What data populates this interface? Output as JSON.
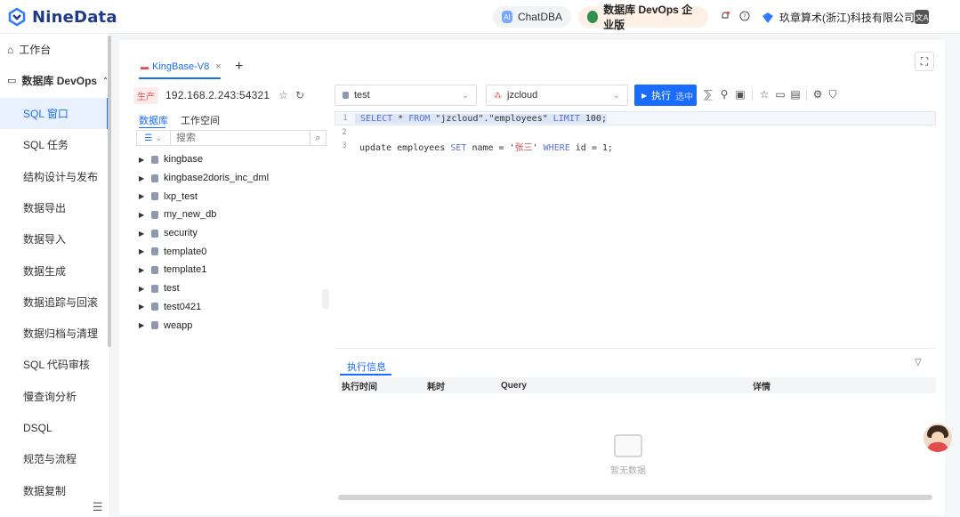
{
  "app": {
    "logo_text": "NineData",
    "chatdba_label": "ChatDBA",
    "devops_label": "数据库 DevOps 企业版",
    "org_name": "玖章算术(浙江)科技有限公司",
    "lang_label": "文A"
  },
  "sidebar": {
    "workbench": "工作台",
    "group": "数据库 DevOps",
    "items": [
      "SQL 窗口",
      "SQL 任务",
      "结构设计与发布",
      "数据导出",
      "数据导入",
      "数据生成",
      "数据追踪与回滚",
      "数据归档与清理",
      "SQL 代码审核",
      "慢查询分析",
      "DSQL",
      "规范与流程",
      "数据复制"
    ],
    "active_index": 0
  },
  "connection": {
    "tab_label": "KingBase-V8",
    "env_badge": "生产",
    "host": "192.168.2.243:54321"
  },
  "db_panel": {
    "tabs": [
      "数据库",
      "工作空间"
    ],
    "search_placeholder": "搜索",
    "databases": [
      "kingbase",
      "kingbase2doris_inc_dml",
      "lxp_test",
      "my_new_db",
      "security",
      "template0",
      "template1",
      "test",
      "test0421",
      "weapp"
    ]
  },
  "editor": {
    "database": "test",
    "schema": "jzcloud",
    "run_label": "执行",
    "run_extra": "选中",
    "lines": [
      {
        "n": "1",
        "parts": [
          [
            "kw",
            "SELECT"
          ],
          [
            "p",
            " * "
          ],
          [
            "kw",
            "FROM"
          ],
          [
            "p",
            " \"jzcloud\".\"employees\" "
          ],
          [
            "kw",
            "LIMIT"
          ],
          [
            "p",
            " 100;"
          ]
        ]
      },
      {
        "n": "2",
        "parts": []
      },
      {
        "n": "3",
        "parts": [
          [
            "p",
            "update employees "
          ],
          [
            "kw",
            "SET"
          ],
          [
            "p",
            " name = '"
          ],
          [
            "cn",
            "张三"
          ],
          [
            "p",
            "' "
          ],
          [
            "kw",
            "WHERE"
          ],
          [
            "p",
            " id = 1;"
          ]
        ]
      }
    ]
  },
  "result": {
    "tab_label": "执行信息",
    "columns": [
      "执行时间",
      "耗时",
      "Query",
      "详情"
    ],
    "empty_text": "暂无数据"
  }
}
